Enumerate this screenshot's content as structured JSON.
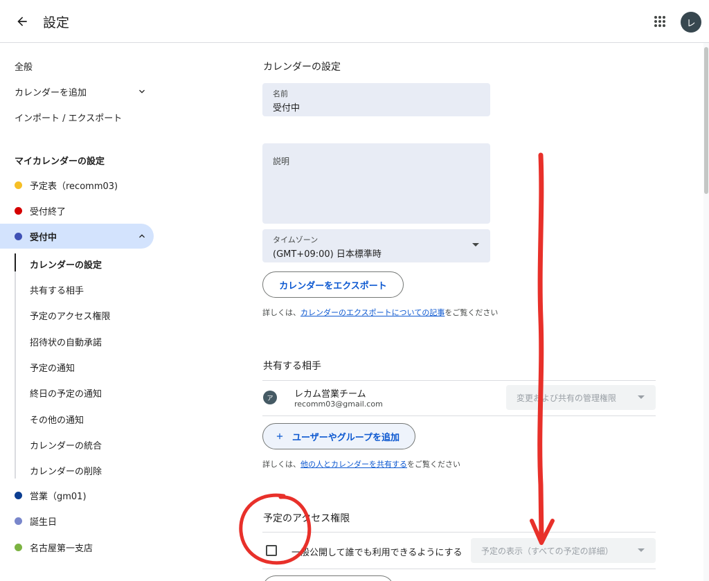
{
  "header": {
    "title": "設定",
    "avatar_letter": "レ"
  },
  "sidebar": {
    "top_items": [
      {
        "label": "全般"
      },
      {
        "label": "カレンダーを追加"
      },
      {
        "label": "インポート / エクスポート"
      }
    ],
    "my_calendars_title": "マイカレンダーの設定",
    "calendars": [
      {
        "label": "予定表（recomm03)",
        "color": "#f6bf26"
      },
      {
        "label": "受付終了",
        "color": "#d50000"
      },
      {
        "label": "受付中",
        "color": "#3f51b5"
      }
    ],
    "sub_items": [
      {
        "label": "カレンダーの設定"
      },
      {
        "label": "共有する相手"
      },
      {
        "label": "予定のアクセス権限"
      },
      {
        "label": "招待状の自動承諾"
      },
      {
        "label": "予定の通知"
      },
      {
        "label": "終日の予定の通知"
      },
      {
        "label": "その他の通知"
      },
      {
        "label": "カレンダーの統合"
      },
      {
        "label": "カレンダーの削除"
      }
    ],
    "other_calendars": [
      {
        "label": "営業（gm01)",
        "color": "#0b3d91"
      },
      {
        "label": "誕生日",
        "color": "#7986cb"
      },
      {
        "label": "名古屋第一支店",
        "color": "#7cb342"
      }
    ]
  },
  "main": {
    "settings_title": "カレンダーの設定",
    "name_field": {
      "label": "名前",
      "value": "受付中"
    },
    "description_field": {
      "label": "説明"
    },
    "timezone_field": {
      "label": "タイムゾーン",
      "value": "(GMT+09:00) 日本標準時"
    },
    "export_button": "カレンダーをエクスポート",
    "export_hint": {
      "prefix": "詳しくは、",
      "link": "カレンダーのエクスポートについての記事",
      "suffix": "をご覧ください"
    },
    "share_title": "共有する相手",
    "share_entry": {
      "avatar_letter": "ア",
      "name": "レカム営業チーム",
      "email": "recomm03@gmail.com",
      "permission": "変更および共有の管理権限"
    },
    "add_people_button": "ユーザーやグループを追加",
    "share_hint": {
      "prefix": "詳しくは、",
      "link": "他の人とカレンダーを共有する",
      "suffix": "をご覧ください"
    },
    "access_title": "予定のアクセス権限",
    "public_checkbox_label": "一般公開して誰でも利用できるようにする",
    "public_visibility": "予定の表示（すべての予定の詳細）"
  },
  "icons": {
    "back": "arrow-left-icon",
    "apps": "apps-grid-icon",
    "chevron": "chevron-icon",
    "plus": "plus-icon"
  },
  "colors": {
    "accent": "#0b57d0",
    "active_nav": "#d3e3fd",
    "field_bg": "#e8ecf5",
    "annotation": "#e8302a"
  }
}
